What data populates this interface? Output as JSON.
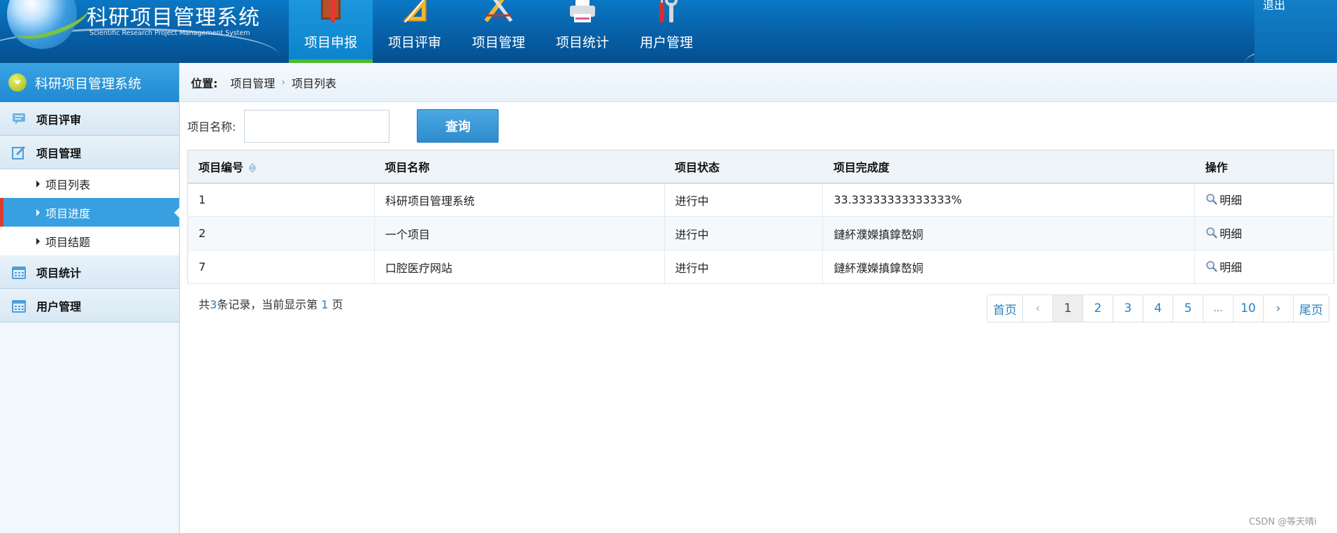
{
  "header": {
    "app_title": "科研项目管理系统",
    "app_subtitle": "Scientific Research Project Management System",
    "nav": [
      {
        "label": "项目申报",
        "icon": "book-icon",
        "active": true
      },
      {
        "label": "项目评审",
        "icon": "ruler-triangle-icon",
        "active": false
      },
      {
        "label": "项目管理",
        "icon": "drafting-tools-icon",
        "active": false
      },
      {
        "label": "项目统计",
        "icon": "printer-icon",
        "active": false
      },
      {
        "label": "用户管理",
        "icon": "tools-icon",
        "active": false
      }
    ],
    "logout_label": "退出"
  },
  "sidebar": {
    "title": "科研项目管理系统",
    "groups": [
      {
        "label": "项目评审",
        "icon": "comment-icon"
      },
      {
        "label": "项目管理",
        "icon": "edit-icon"
      },
      {
        "label": "项目统计",
        "icon": "calendar-icon"
      },
      {
        "label": "用户管理",
        "icon": "calendar-icon"
      }
    ],
    "sub_items": [
      {
        "label": "项目列表",
        "active": false
      },
      {
        "label": "项目进度",
        "active": true
      },
      {
        "label": "项目结题",
        "active": false
      }
    ]
  },
  "breadcrumb": {
    "prefix": "位置:",
    "items": [
      "项目管理",
      "项目列表"
    ]
  },
  "search": {
    "label": "项目名称:",
    "value": "",
    "button_label": "查询"
  },
  "table": {
    "columns": [
      "项目编号",
      "项目名称",
      "项目状态",
      "项目完成度",
      "操作"
    ],
    "rows": [
      {
        "id": "1",
        "name": "科研项目管理系统",
        "status": "进行中",
        "progress": "33.33333333333333%",
        "action": "明细"
      },
      {
        "id": "2",
        "name": "一个项目",
        "status": "进行中",
        "progress": "鏈紑濮嬫搷鎿嶅姛",
        "action": "明细"
      },
      {
        "id": "7",
        "name": "口腔医疗网站",
        "status": "进行中",
        "progress": "鏈紑濮嬫搷鎿嶅姛",
        "action": "明细"
      }
    ]
  },
  "summary": {
    "prefix": "共",
    "total": "3",
    "middle": "条记录，当前显示第 ",
    "page": "1",
    "suffix": " 页"
  },
  "pager": {
    "first": "首页",
    "prev": "‹",
    "pages": [
      "1",
      "2",
      "3",
      "4",
      "5"
    ],
    "ellipsis": "...",
    "last_page": "10",
    "next": "›",
    "last": "尾页",
    "current": "1"
  },
  "watermark": "CSDN @等天晴i",
  "colors": {
    "header_blue": "#075fa6",
    "active_blue": "#38a0e0",
    "active_underline": "#4ab92f",
    "active_marker": "#e03a2e",
    "link_blue": "#2a7fc0"
  }
}
